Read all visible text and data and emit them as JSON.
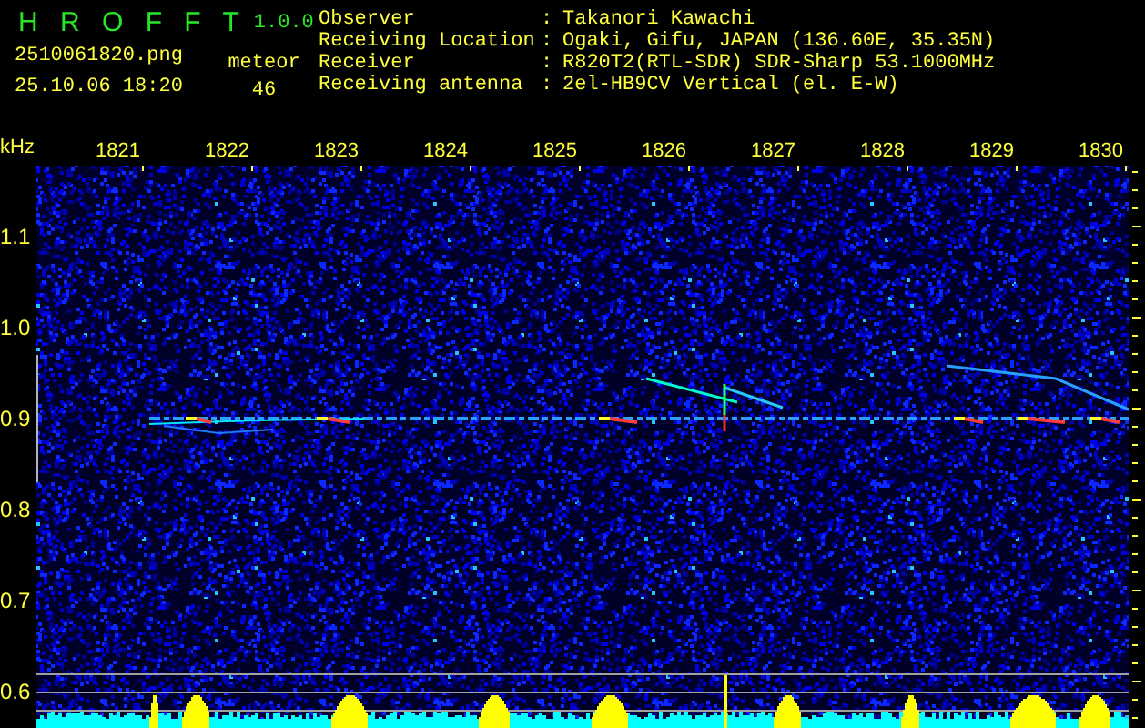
{
  "app": {
    "title": "H R O F F T",
    "version": "1.0.0",
    "file": "2510061820.png",
    "timestamp": "25.10.06 18:20",
    "count_label": "meteor",
    "count": "46"
  },
  "info": [
    {
      "label": "Observer",
      "separator": ":",
      "value": "Takanori Kawachi"
    },
    {
      "label": "Receiving Location",
      "separator": ":",
      "value": "Ogaki, Gifu, JAPAN (136.60E, 35.35N)"
    },
    {
      "label": "Receiver",
      "separator": ":",
      "value": "R820T2(RTL-SDR) SDR-Sharp 53.1000MHz"
    },
    {
      "label": "Receiving antenna",
      "separator": ":",
      "value": "2el-HB9CV Vertical (el. E-W)"
    }
  ],
  "spectrogram": {
    "x_unit": "kHz",
    "x_ticks": [
      "1821",
      "1822",
      "1823",
      "1824",
      "1825",
      "1826",
      "1827",
      "1828",
      "1829",
      "1830"
    ],
    "y_ticks": [
      "1.1",
      "1.0",
      "0.9",
      "0.8",
      "0.7",
      "0.6"
    ]
  }
}
